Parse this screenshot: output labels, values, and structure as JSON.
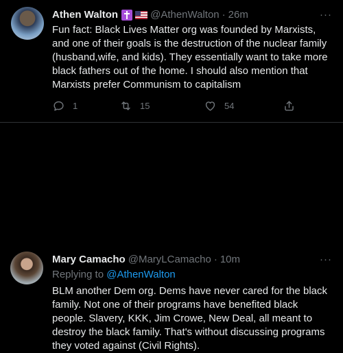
{
  "tweets": [
    {
      "name": "Athen Walton",
      "handle": "@AthenWalton",
      "separator": "·",
      "time": "26m",
      "more": "···",
      "badges": [
        "latin-cross-icon",
        "us-flag-icon"
      ],
      "text": "Fun fact: Black Lives Matter org was founded by Marxists,\nand one of their goals is the destruction of the nuclear family\n(husband,wife, and kids). They essentially want to take more\nblack fathers out of the home. I should also mention that\nMarxists prefer Communism to capitalism",
      "actions": {
        "reply_count": "1",
        "retweet_count": "15",
        "like_count": "54"
      }
    },
    {
      "name": "Mary Camacho",
      "handle": "@MaryLCamacho",
      "separator": "·",
      "time": "10m",
      "more": "···",
      "replying_to_label": "Replying to ",
      "replying_to_handle": "@AthenWalton",
      "text": "BLM another Dem org. Dems have never cared for the black\nfamily. Not one of their programs have benefited black\npeople. Slavery, KKK, Jim Crowe, New Deal, all meant to\ndestroy the black family. That's without discussing programs\nthey voted against (Civil Rights)."
    }
  ],
  "colors": {
    "background": "#000000",
    "text": "#e7e9ea",
    "muted": "#71767b",
    "link": "#1d9bf0",
    "divider": "#2f3336"
  }
}
